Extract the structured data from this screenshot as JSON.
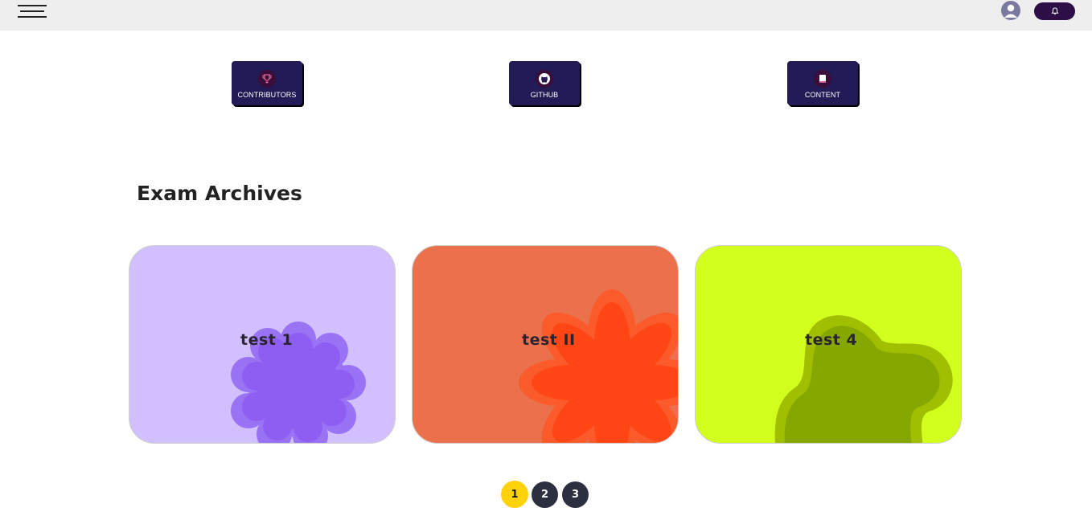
{
  "header": {
    "menu_icon": "hamburger-icon",
    "avatar_icon": "user-avatar-icon",
    "notification_icon": "bell-icon"
  },
  "quick_links": [
    {
      "label": "CONTRIBUTORS",
      "icon": "trophy-icon"
    },
    {
      "label": "GITHUB",
      "icon": "github-icon"
    },
    {
      "label": "CONTENT",
      "icon": "book-icon"
    }
  ],
  "main": {
    "section_title": "Exam Archives",
    "cards": [
      {
        "title": "test 1",
        "bg": "#d2bffd",
        "shape_color": "#8e5ef3",
        "shape": "flower-scallop"
      },
      {
        "title": "test II",
        "bg": "#ea714c",
        "shape_color": "#ff4614",
        "shape": "star-petals"
      },
      {
        "title": "test 4",
        "bg": "#d3ff1e",
        "shape_color": "#86a600",
        "shape": "blob"
      }
    ]
  },
  "pagination": {
    "pages": [
      "1",
      "2",
      "3"
    ],
    "current": "1",
    "active_color": "#ffd20a",
    "inactive_color": "#2c2f40"
  }
}
